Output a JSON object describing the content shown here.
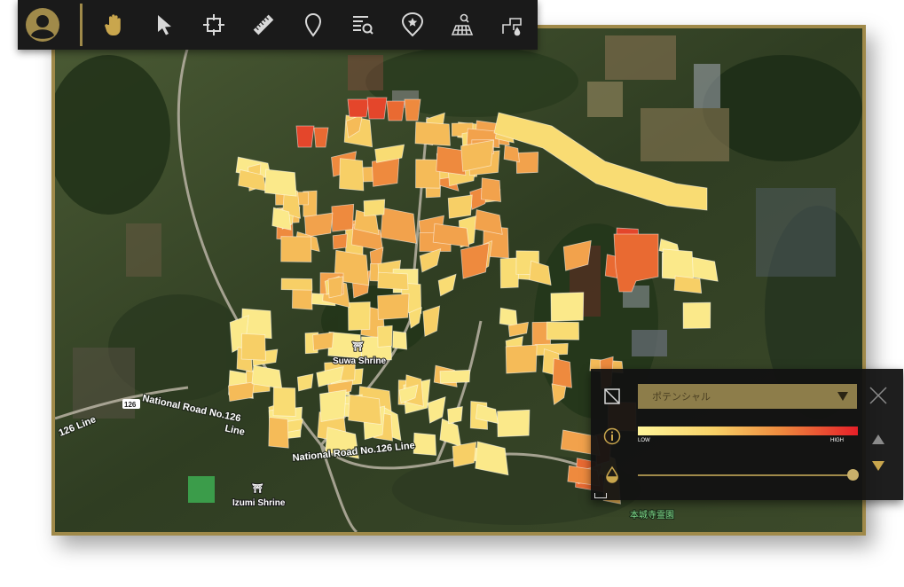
{
  "toolbar": {
    "tools": [
      "user-avatar",
      "hand-pan",
      "select-cursor",
      "crosshair-target",
      "ruler",
      "map-pin",
      "search-list",
      "favorite-location",
      "field-search",
      "water-pipe"
    ]
  },
  "map": {
    "labels": {
      "suwa_shrine": "Suwa Shrine",
      "izumi_shrine": "Izumi Shrine",
      "national_road_upper": "National Road No.126",
      "line_upper": "Line",
      "national_road_lower": "National Road No.126 Line",
      "line_left": "126 Line",
      "route_badge": "126",
      "park_label": "本城寺霊園"
    }
  },
  "panel": {
    "layer_select": "ポテンシャル",
    "legend_low": "LOW",
    "legend_high": "HIGH",
    "opacity_fraction": 1.0,
    "colors": {
      "accent": "#a08a4a",
      "low": "#fff59a",
      "high": "#e51f28"
    }
  }
}
